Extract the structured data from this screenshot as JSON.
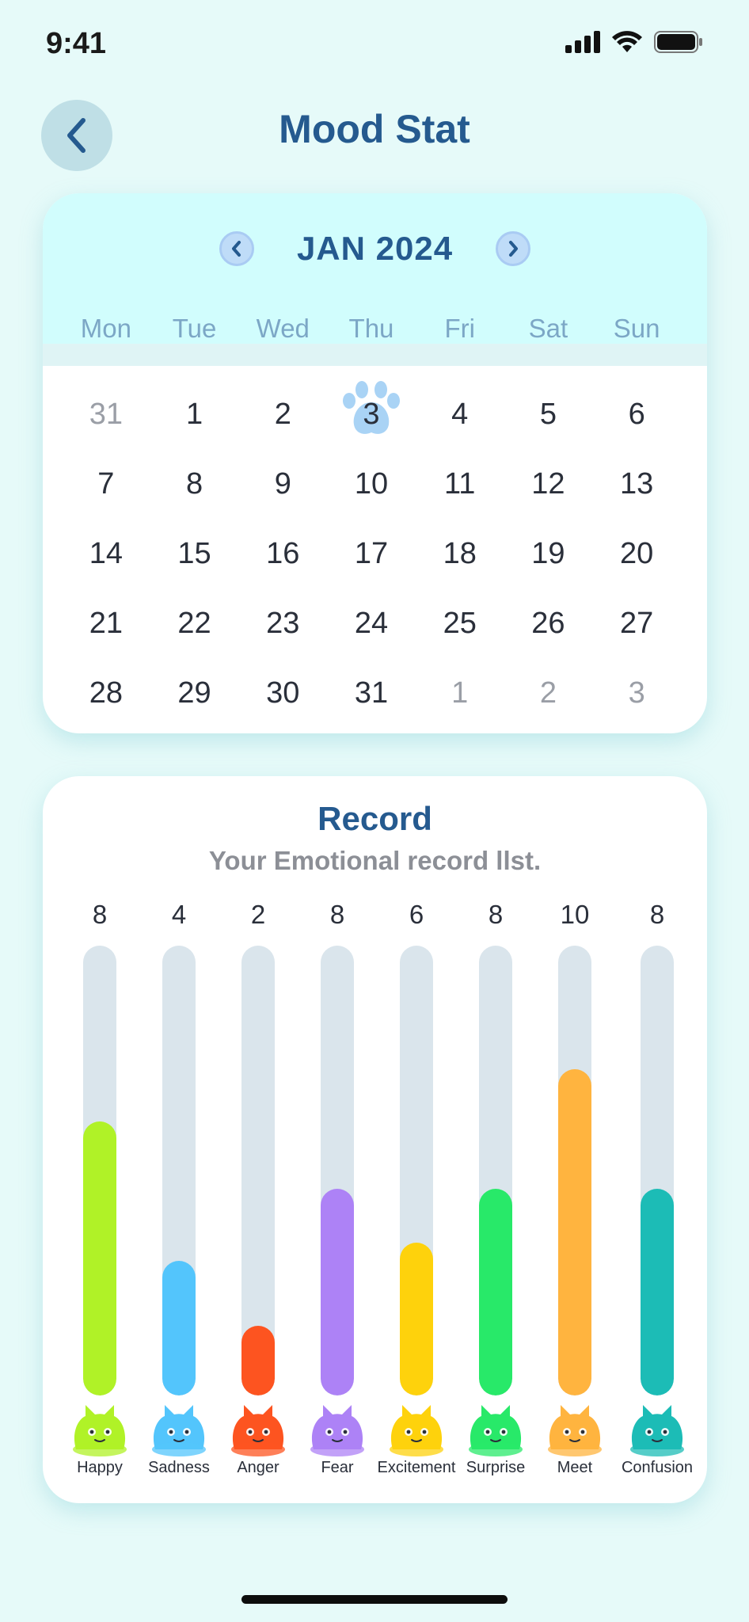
{
  "status": {
    "time": "9:41"
  },
  "header": {
    "title": "Mood Stat"
  },
  "calendar": {
    "month_label": "JAN 2024",
    "weekdays": [
      "Mon",
      "Tue",
      "Wed",
      "Thu",
      "Fri",
      "Sat",
      "Sun"
    ],
    "days": [
      {
        "d": "31",
        "muted": true
      },
      {
        "d": "1"
      },
      {
        "d": "2"
      },
      {
        "d": "3",
        "selected": true
      },
      {
        "d": "4"
      },
      {
        "d": "5"
      },
      {
        "d": "6"
      },
      {
        "d": "7"
      },
      {
        "d": "8"
      },
      {
        "d": "9"
      },
      {
        "d": "10"
      },
      {
        "d": "11"
      },
      {
        "d": "12"
      },
      {
        "d": "13"
      },
      {
        "d": "14"
      },
      {
        "d": "15"
      },
      {
        "d": "16"
      },
      {
        "d": "17"
      },
      {
        "d": "18"
      },
      {
        "d": "19"
      },
      {
        "d": "20"
      },
      {
        "d": "21"
      },
      {
        "d": "22"
      },
      {
        "d": "23"
      },
      {
        "d": "24"
      },
      {
        "d": "25"
      },
      {
        "d": "26"
      },
      {
        "d": "27"
      },
      {
        "d": "28"
      },
      {
        "d": "29"
      },
      {
        "d": "30"
      },
      {
        "d": "31"
      },
      {
        "d": "1",
        "muted": true
      },
      {
        "d": "2",
        "muted": true
      },
      {
        "d": "3",
        "muted": true
      }
    ],
    "selected_marker_color": "#a9d3f5"
  },
  "record": {
    "title": "Record",
    "subtitle": "Your Emotional record llst."
  },
  "chart_data": {
    "type": "bar",
    "categories": [
      "Happy",
      "Sadness",
      "Anger",
      "Fear",
      "Excitement",
      "Surprise",
      "Meet",
      "Confusion"
    ],
    "values": [
      8,
      4,
      2,
      8,
      6,
      8,
      10,
      8
    ],
    "fill_fractions": [
      0.61,
      0.3,
      0.155,
      0.46,
      0.34,
      0.46,
      0.725,
      0.46
    ],
    "colors": [
      "#b0f227",
      "#53c5fc",
      "#fd5420",
      "#ad82f6",
      "#fed20c",
      "#28e969",
      "#ffb43f",
      "#1cbcb6"
    ]
  }
}
